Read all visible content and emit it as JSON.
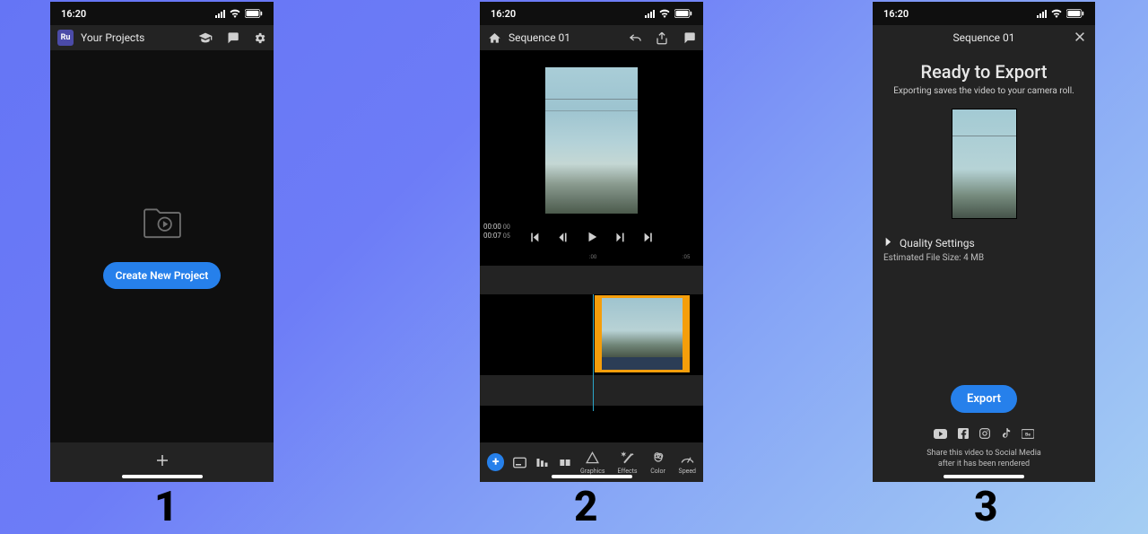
{
  "status": {
    "time": "16:20"
  },
  "screen1": {
    "title": "Your Projects",
    "logo_text": "Ru",
    "create_label": "Create New Project"
  },
  "screen2": {
    "title": "Sequence 01",
    "time_current": "00:00",
    "time_cur_frames": "00",
    "time_total": "00:07",
    "time_tot_frames": "05",
    "ruler_mark_a": ":00",
    "ruler_mark_b": ":05",
    "tools": {
      "graphics": "Graphics",
      "effects": "Effects",
      "color": "Color",
      "speed": "Speed"
    }
  },
  "screen3": {
    "title": "Sequence 01",
    "heading": "Ready to Export",
    "sub": "Exporting saves the video to your camera roll.",
    "quality_label": "Quality Settings",
    "estimate": "Estimated File Size: 4 MB",
    "export_label": "Export",
    "share_note_l1": "Share this video to Social Media",
    "share_note_l2": "after it has been rendered"
  },
  "steps": {
    "s1": "1",
    "s2": "2",
    "s3": "3"
  }
}
